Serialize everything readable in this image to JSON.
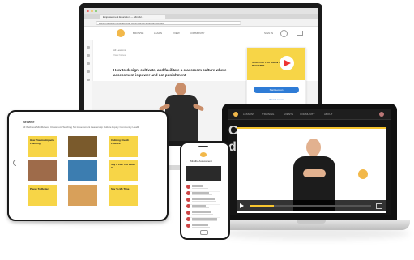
{
  "monitor": {
    "tab_label": "Empowerment Education — Mindful...",
    "url": "www.empowermenteducation.com/course/classroom-culture",
    "nav": [
      "BROWSE",
      "LEARN",
      "VIEW",
      "COMMUNITY"
    ],
    "user_label": "SIGN IN",
    "crumb": "All Lessons",
    "crumb2": "View Notes",
    "lesson_title": "How to design, cultivate, and facilitate a classroom culture where assessment is power and not punishment",
    "cta_text": "JUST FOR YOU WHEN YOU REGISTER",
    "cta_button": "Start Lesson",
    "cta_link": "Save Lesson"
  },
  "laptop": {
    "nav": [
      "LESSONS",
      "TRAINING",
      "EVENTS",
      "COMMUNITY",
      "ABOUT"
    ],
    "title_fragment": "deo",
    "left_fragment": "Co"
  },
  "tablet": {
    "heading": "Browse",
    "filters": "All   Wellness   Mindfulness   Classroom   Teaching   Sel   Assessment   Leadership   Culture   Equity   Community   Health",
    "thumbs": [
      {
        "label": "How Trauma Impacts Learning",
        "color": "#f7d547"
      },
      {
        "label": "",
        "color": "#7a5a2c"
      },
      {
        "label": "Calming Breath Practice",
        "color": "#f7d547"
      },
      {
        "label": "",
        "color": "#9e6b4a"
      },
      {
        "label": "",
        "color": "#3c7db0"
      },
      {
        "label": "Say It Like You Mean It",
        "color": "#f7d547"
      },
      {
        "label": "Pause To Reflect",
        "color": "#f7d547"
      },
      {
        "label": "",
        "color": "#d8a05a"
      },
      {
        "label": "Say To Me Time",
        "color": "#f7d547"
      }
    ]
  },
  "phone": {
    "title": "Mindful Assessment",
    "rows": [
      "",
      "",
      "",
      "",
      "",
      "",
      ""
    ]
  }
}
